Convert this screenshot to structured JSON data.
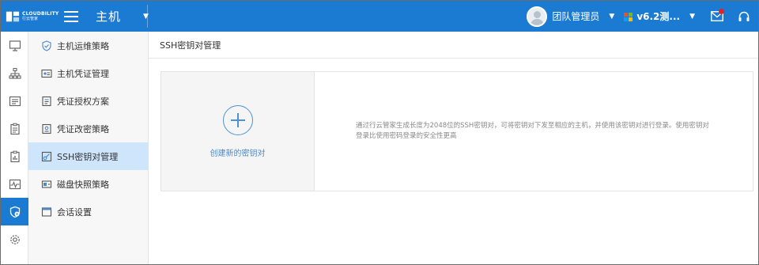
{
  "app": {
    "logo_en": "CLOUDBILITY",
    "logo_cn": "行云管家",
    "module_title": "主机"
  },
  "header": {
    "user_name": "团队管理员",
    "version_label": "v6.2测...",
    "accent_color": "#1b7ad1",
    "notification_color": "#e02424"
  },
  "iconbar": {
    "items": [
      {
        "icon": "monitor-icon"
      },
      {
        "icon": "topology-icon"
      },
      {
        "icon": "list-icon"
      },
      {
        "icon": "clipboard-icon"
      },
      {
        "icon": "report-icon"
      },
      {
        "icon": "activity-icon"
      },
      {
        "icon": "shield-gear-icon",
        "active": true
      },
      {
        "icon": "gear-icon"
      }
    ]
  },
  "sidebar": {
    "items": [
      {
        "label": "主机运维策略",
        "icon": "shield-check-icon"
      },
      {
        "label": "主机凭证管理",
        "icon": "credential-icon"
      },
      {
        "label": "凭证授权方案",
        "icon": "authorization-icon"
      },
      {
        "label": "凭证改密策略",
        "icon": "password-change-icon"
      },
      {
        "label": "SSH密钥对管理",
        "icon": "key-icon",
        "active": true
      },
      {
        "label": "磁盘快照策略",
        "icon": "disk-icon"
      },
      {
        "label": "会话设置",
        "icon": "window-icon"
      }
    ]
  },
  "page": {
    "title": "SSH密钥对管理",
    "create_label": "创建新的密钥对",
    "description": "通过行云管家生成长度为2048位的SSH密钥对，可将密钥对下发至相应的主机，并使用该密钥对进行登录。使用密钥对登录比使用密码登录的安全性更高"
  }
}
